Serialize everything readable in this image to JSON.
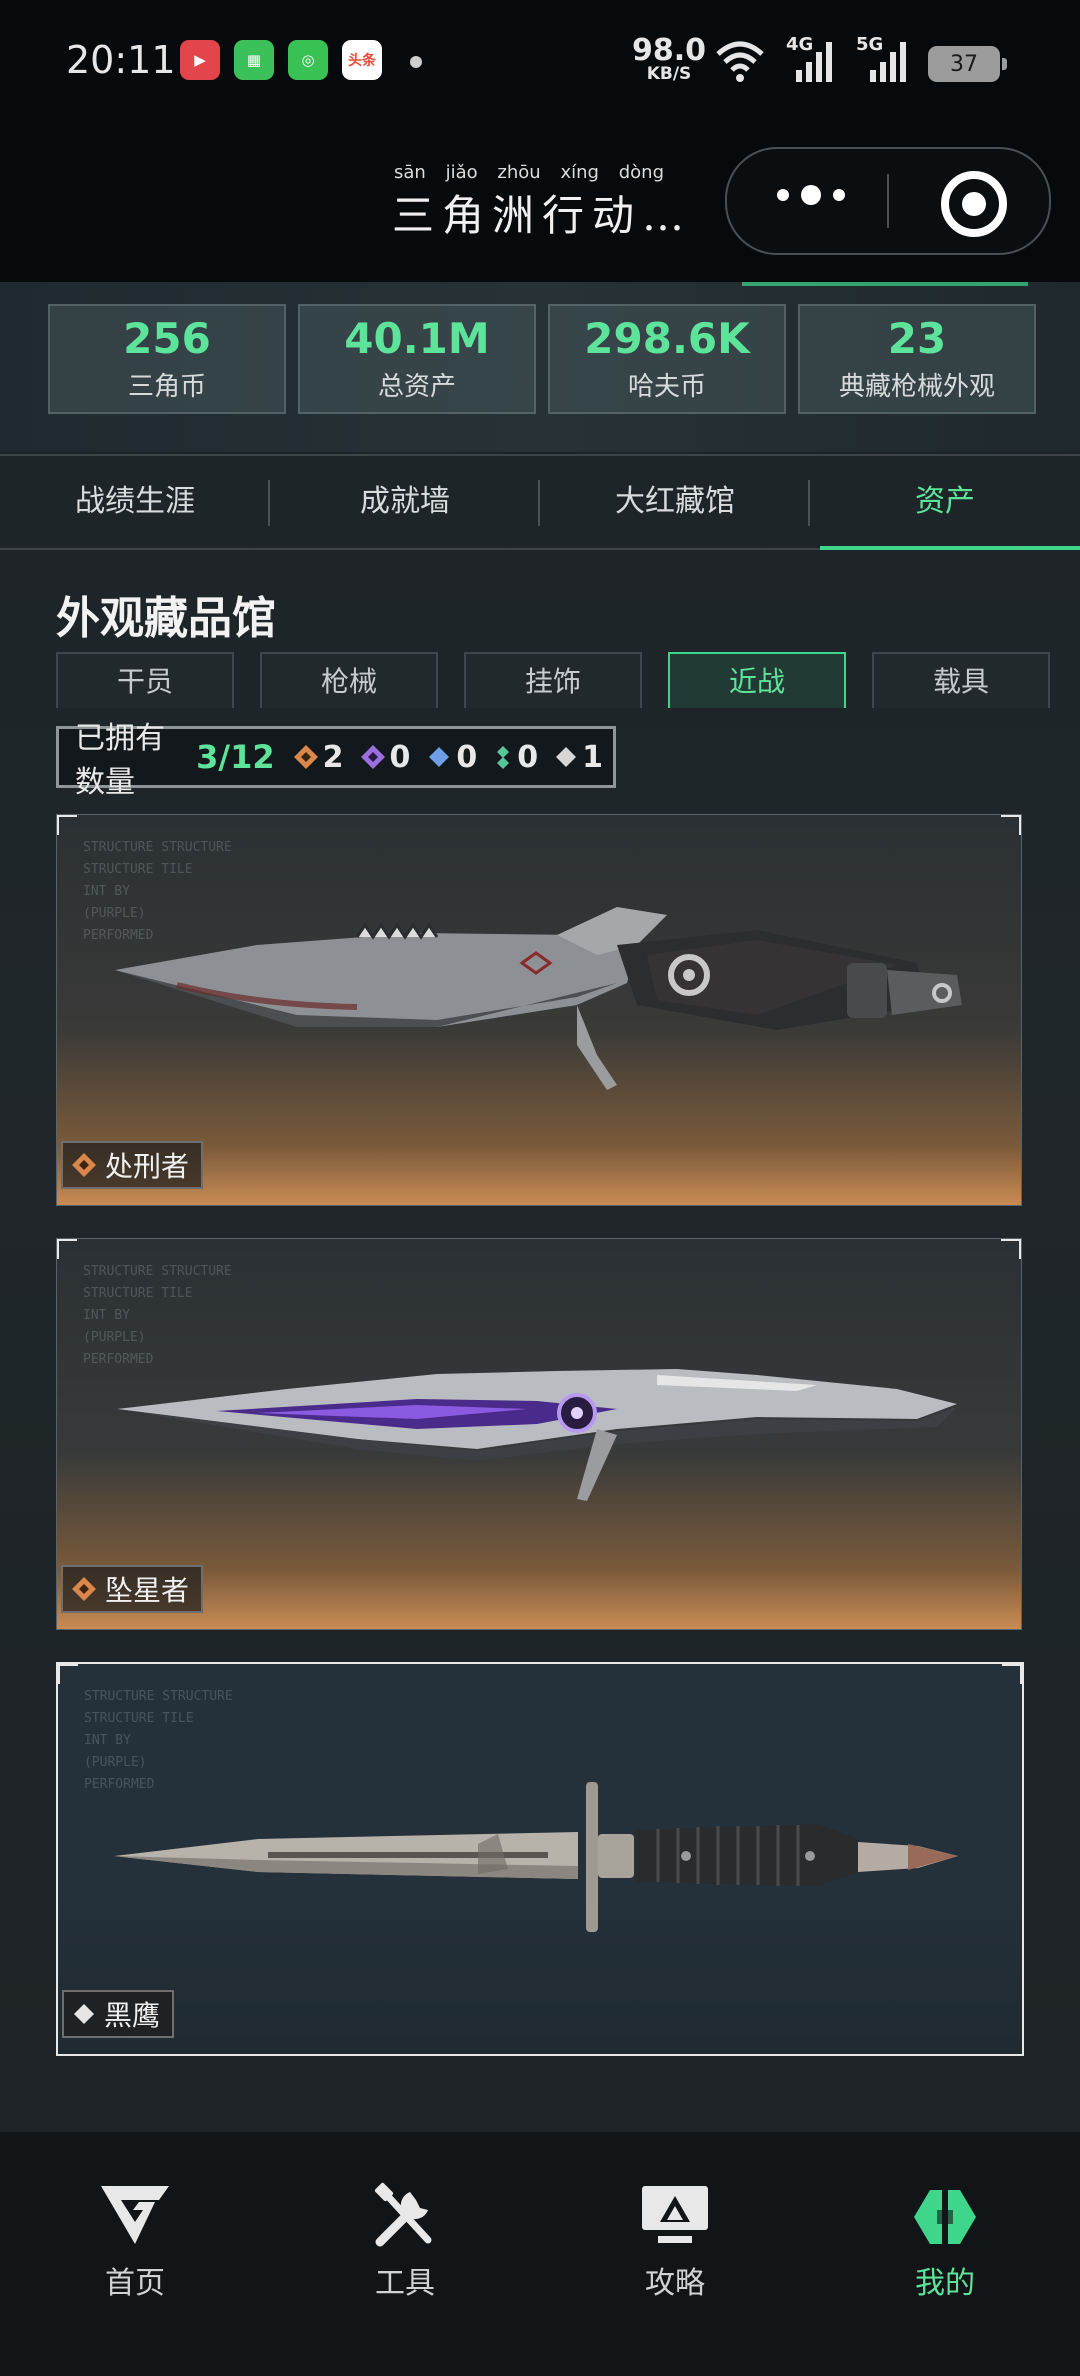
{
  "status_bar": {
    "time": "20:11",
    "apps": [
      {
        "name": "video-app-icon",
        "color": "#e2464a",
        "glyph": "▶"
      },
      {
        "name": "shop-app-icon",
        "color": "#3cc05a",
        "glyph": "▦"
      },
      {
        "name": "camera-app-icon",
        "color": "#39c253",
        "glyph": "◎"
      },
      {
        "name": "toutiao-app-icon",
        "color": "#e74b3c",
        "glyph": "头条"
      }
    ],
    "net_speed": "98.0",
    "net_unit": "KB/S",
    "net1": "4G",
    "net2": "5G",
    "battery": "37"
  },
  "title_bar": {
    "title": "三角洲行动…",
    "pinyin": [
      "sān",
      "jiǎo",
      "zhōu",
      "xíng",
      "dòng"
    ]
  },
  "stats": [
    {
      "value": "256",
      "label": "三角币"
    },
    {
      "value": "40.1M",
      "label": "总资产"
    },
    {
      "value": "298.6K",
      "label": "哈夫币"
    },
    {
      "value": "23",
      "label": "典藏枪械外观"
    }
  ],
  "tabs": [
    "战绩生涯",
    "成就墙",
    "大红藏馆",
    "资产"
  ],
  "active_tab": "资产",
  "section_title": "外观藏品馆",
  "sub_tabs": [
    "干员",
    "枪械",
    "挂饰",
    "近战",
    "载具"
  ],
  "active_sub_tab": "近战",
  "owned": {
    "label": "已拥有数量",
    "count": "3/12",
    "rarities": [
      {
        "name": "gold-rarity-icon",
        "color": "#d9874a",
        "count": "2"
      },
      {
        "name": "purple-rarity-icon",
        "color": "#9b6fe0",
        "count": "0"
      },
      {
        "name": "blue-rarity-icon",
        "color": "#6f9fe6",
        "count": "0"
      },
      {
        "name": "green-rarity-icon",
        "color": "#56c79a",
        "count": "0"
      },
      {
        "name": "white-rarity-icon",
        "color": "#d6d6d6",
        "count": "1"
      }
    ]
  },
  "items": [
    {
      "name": "处刑者",
      "rarity_color": "#d9874a",
      "style": "gold"
    },
    {
      "name": "坠星者",
      "rarity_color": "#d9874a",
      "style": "gold"
    },
    {
      "name": "黑鹰",
      "rarity_color": "#e6e6e6",
      "style": "white"
    }
  ],
  "card_faint_text": [
    "STRUCTURE STRUCTURE",
    "STRUCTURE TILE",
    "INT BY",
    "",
    "(PURPLE)",
    "",
    "PERFORMED"
  ],
  "bottom_nav": [
    {
      "label": "首页",
      "icon": "home-logo-icon"
    },
    {
      "label": "工具",
      "icon": "tools-icon"
    },
    {
      "label": "攻略",
      "icon": "guide-monitor-icon"
    },
    {
      "label": "我的",
      "icon": "profile-logo-icon"
    }
  ],
  "active_nav": "我的",
  "colors": {
    "accent": "#5ee39a",
    "gold": "#d9874a"
  }
}
